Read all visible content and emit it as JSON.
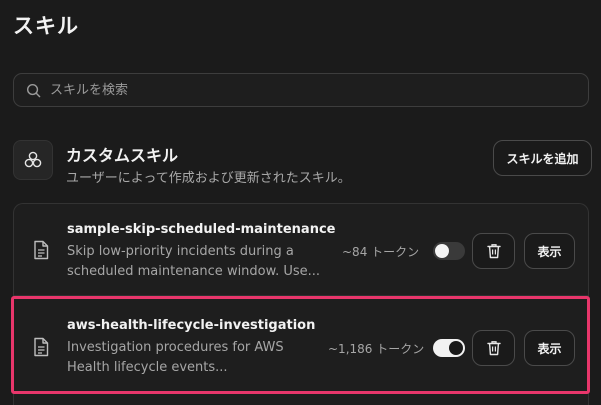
{
  "page": {
    "title": "スキル"
  },
  "search": {
    "placeholder": "スキルを検索",
    "value": ""
  },
  "section": {
    "title": "カスタムスキル",
    "description": "ユーザーによって作成および更新されたスキル。",
    "add_button_label": "スキルを追加"
  },
  "skills": [
    {
      "name": "sample-skip-scheduled-maintenance",
      "description_line1": "Skip low-priority incidents during a",
      "description_line2": "scheduled maintenance window. Use...",
      "tokens": "~84 トークン",
      "enabled": false,
      "view_label": "表示"
    },
    {
      "name": "aws-health-lifecycle-investigation",
      "description_line1": "Investigation procedures for AWS",
      "description_line2": "Health lifecycle events...",
      "tokens": "~1,186 トークン",
      "enabled": true,
      "view_label": "表示"
    }
  ],
  "colors": {
    "background": "#1b1b1b",
    "highlight": "#e8366b",
    "toggle_on": "#f2f2f2",
    "toggle_off": "#3a3a3a"
  },
  "icons": {
    "search": "search-icon",
    "section": "skills-cluster-icon",
    "skill": "document-icon",
    "delete": "trash-icon"
  }
}
